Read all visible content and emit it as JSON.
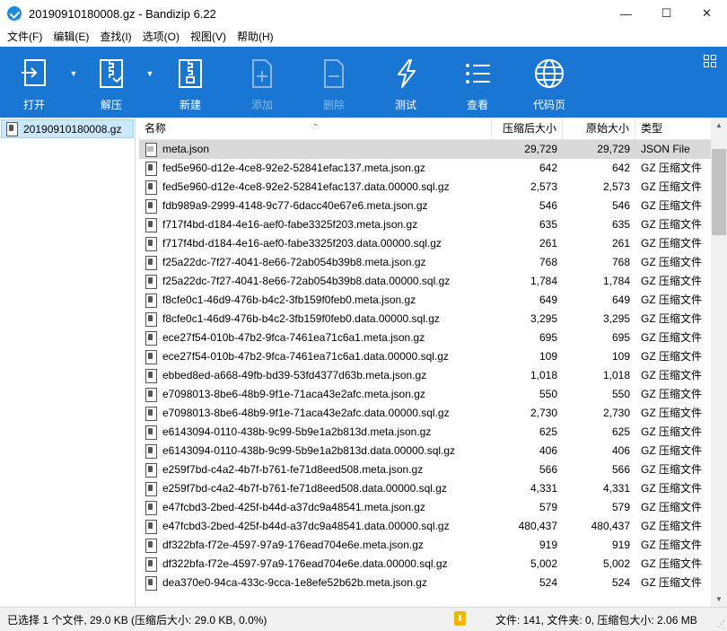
{
  "window": {
    "title": "20190910180008.gz - Bandizip 6.22",
    "minimize": "—",
    "maximize": "☐",
    "close": "✕"
  },
  "menu": [
    "文件(F)",
    "编辑(E)",
    "查找(I)",
    "选项(O)",
    "视图(V)",
    "帮助(H)"
  ],
  "toolbar": {
    "open": "打开",
    "extract": "解压",
    "new": "新建",
    "add": "添加",
    "delete": "删除",
    "test": "测试",
    "view": "查看",
    "codepage": "代码页",
    "accent": "#1976d2"
  },
  "tree": {
    "root": "20190910180008.gz"
  },
  "columns": {
    "name": "名称",
    "compressed": "压缩后大小",
    "original": "原始大小",
    "type": "类型"
  },
  "rows": [
    {
      "name": "meta.json",
      "compressed": "29,729",
      "original": "29,729",
      "type": "JSON File",
      "icon": "json"
    },
    {
      "name": "fed5e960-d12e-4ce8-92e2-52841efac137.meta.json.gz",
      "compressed": "642",
      "original": "642",
      "type": "GZ 压缩文件",
      "icon": "gz"
    },
    {
      "name": "fed5e960-d12e-4ce8-92e2-52841efac137.data.00000.sql.gz",
      "compressed": "2,573",
      "original": "2,573",
      "type": "GZ 压缩文件",
      "icon": "gz"
    },
    {
      "name": "fdb989a9-2999-4148-9c77-6dacc40e67e6.meta.json.gz",
      "compressed": "546",
      "original": "546",
      "type": "GZ 压缩文件",
      "icon": "gz"
    },
    {
      "name": "f717f4bd-d184-4e16-aef0-fabe3325f203.meta.json.gz",
      "compressed": "635",
      "original": "635",
      "type": "GZ 压缩文件",
      "icon": "gz"
    },
    {
      "name": "f717f4bd-d184-4e16-aef0-fabe3325f203.data.00000.sql.gz",
      "compressed": "261",
      "original": "261",
      "type": "GZ 压缩文件",
      "icon": "gz"
    },
    {
      "name": "f25a22dc-7f27-4041-8e66-72ab054b39b8.meta.json.gz",
      "compressed": "768",
      "original": "768",
      "type": "GZ 压缩文件",
      "icon": "gz"
    },
    {
      "name": "f25a22dc-7f27-4041-8e66-72ab054b39b8.data.00000.sql.gz",
      "compressed": "1,784",
      "original": "1,784",
      "type": "GZ 压缩文件",
      "icon": "gz"
    },
    {
      "name": "f8cfe0c1-46d9-476b-b4c2-3fb159f0feb0.meta.json.gz",
      "compressed": "649",
      "original": "649",
      "type": "GZ 压缩文件",
      "icon": "gz"
    },
    {
      "name": "f8cfe0c1-46d9-476b-b4c2-3fb159f0feb0.data.00000.sql.gz",
      "compressed": "3,295",
      "original": "3,295",
      "type": "GZ 压缩文件",
      "icon": "gz"
    },
    {
      "name": "ece27f54-010b-47b2-9fca-7461ea71c6a1.meta.json.gz",
      "compressed": "695",
      "original": "695",
      "type": "GZ 压缩文件",
      "icon": "gz"
    },
    {
      "name": "ece27f54-010b-47b2-9fca-7461ea71c6a1.data.00000.sql.gz",
      "compressed": "109",
      "original": "109",
      "type": "GZ 压缩文件",
      "icon": "gz"
    },
    {
      "name": "ebbed8ed-a668-49fb-bd39-53fd4377d63b.meta.json.gz",
      "compressed": "1,018",
      "original": "1,018",
      "type": "GZ 压缩文件",
      "icon": "gz"
    },
    {
      "name": "e7098013-8be6-48b9-9f1e-71aca43e2afc.meta.json.gz",
      "compressed": "550",
      "original": "550",
      "type": "GZ 压缩文件",
      "icon": "gz"
    },
    {
      "name": "e7098013-8be6-48b9-9f1e-71aca43e2afc.data.00000.sql.gz",
      "compressed": "2,730",
      "original": "2,730",
      "type": "GZ 压缩文件",
      "icon": "gz"
    },
    {
      "name": "e6143094-0110-438b-9c99-5b9e1a2b813d.meta.json.gz",
      "compressed": "625",
      "original": "625",
      "type": "GZ 压缩文件",
      "icon": "gz"
    },
    {
      "name": "e6143094-0110-438b-9c99-5b9e1a2b813d.data.00000.sql.gz",
      "compressed": "406",
      "original": "406",
      "type": "GZ 压缩文件",
      "icon": "gz"
    },
    {
      "name": "e259f7bd-c4a2-4b7f-b761-fe71d8eed508.meta.json.gz",
      "compressed": "566",
      "original": "566",
      "type": "GZ 压缩文件",
      "icon": "gz"
    },
    {
      "name": "e259f7bd-c4a2-4b7f-b761-fe71d8eed508.data.00000.sql.gz",
      "compressed": "4,331",
      "original": "4,331",
      "type": "GZ 压缩文件",
      "icon": "gz"
    },
    {
      "name": "e47fcbd3-2bed-425f-b44d-a37dc9a48541.meta.json.gz",
      "compressed": "579",
      "original": "579",
      "type": "GZ 压缩文件",
      "icon": "gz"
    },
    {
      "name": "e47fcbd3-2bed-425f-b44d-a37dc9a48541.data.00000.sql.gz",
      "compressed": "480,437",
      "original": "480,437",
      "type": "GZ 压缩文件",
      "icon": "gz"
    },
    {
      "name": "df322bfa-f72e-4597-97a9-176ead704e6e.meta.json.gz",
      "compressed": "919",
      "original": "919",
      "type": "GZ 压缩文件",
      "icon": "gz"
    },
    {
      "name": "df322bfa-f72e-4597-97a9-176ead704e6e.data.00000.sql.gz",
      "compressed": "5,002",
      "original": "5,002",
      "type": "GZ 压缩文件",
      "icon": "gz"
    },
    {
      "name": "dea370e0-94ca-433c-9cca-1e8efe52b62b.meta.json.gz",
      "compressed": "524",
      "original": "524",
      "type": "GZ 压缩文件",
      "icon": "gz"
    }
  ],
  "status": {
    "selection": "已选择 1 个文件, 29.0 KB (压缩后大小: 29.0 KB, 0.0%)",
    "summary": "文件: 141, 文件夹: 0, 压缩包大小: 2.06 MB"
  }
}
